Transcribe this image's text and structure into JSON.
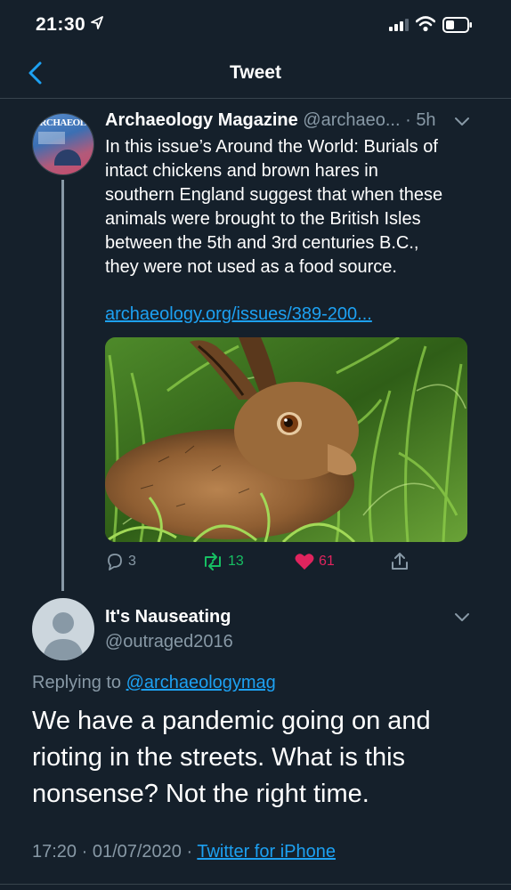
{
  "status_bar": {
    "time": "21:30"
  },
  "nav": {
    "title": "Tweet"
  },
  "original_tweet": {
    "avatar_text": "ARCHAEOLOGY",
    "name": "Archaeology Magazine",
    "handle": "@archaeo...",
    "separator": " · ",
    "time_ago": "5h",
    "lines": [
      "In this issue’s Around the World: Burials of",
      "intact chickens and brown hares in",
      "southern England suggest that when these",
      "animals were brought to the British Isles",
      "between the 5th and 3rd centuries B.C.,",
      "they were not used as a food source."
    ],
    "link": "archaeology.org/issues/389-200...",
    "actions": {
      "replies": "3",
      "retweets": "13",
      "likes": "61"
    }
  },
  "reply_tweet": {
    "name": "It's Nauseating",
    "handle": "@outraged2016",
    "replying_prefix": "Replying to",
    "replying_to": "@archaeologymag",
    "lines": [
      "We have a pandemic going on and",
      "rioting in the streets. What is this",
      "nonsense? Not the right time."
    ],
    "timestamp": "17:20 · 01/07/2020 · ",
    "source": "Twitter for iPhone"
  },
  "colors": {
    "background": "#15202b",
    "accent": "#1da1f2",
    "muted": "#8899a6",
    "retweet_green": "#17bf63",
    "like_pink": "#e0245e"
  }
}
